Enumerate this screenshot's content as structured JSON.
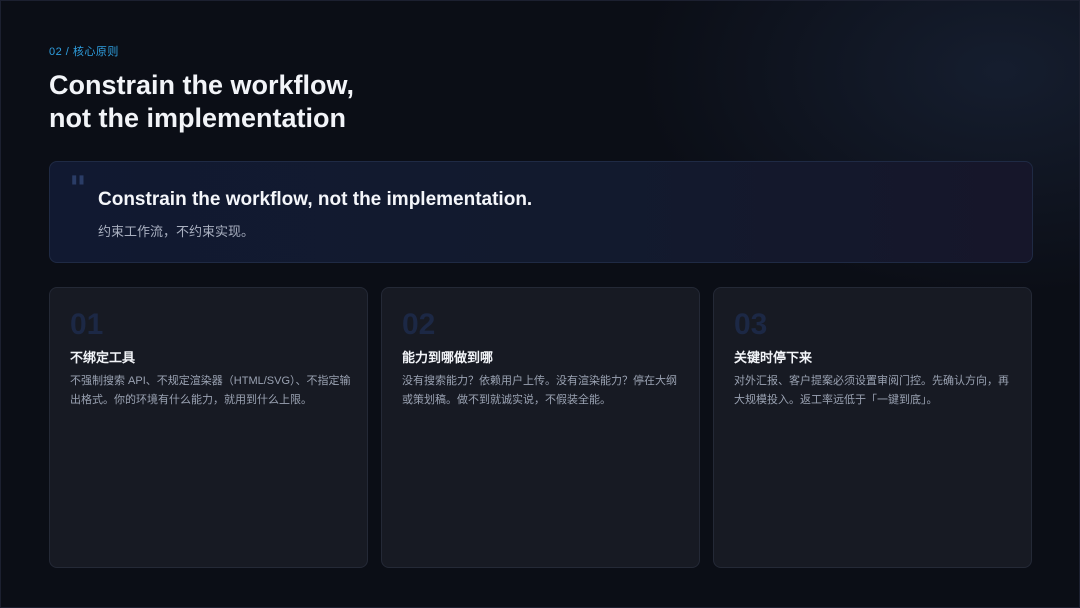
{
  "kicker": "02 / 核心原则",
  "heading": {
    "line1": "Constrain the workflow,",
    "line2": "not the implementation"
  },
  "quote": {
    "mark": "\"",
    "english": "Constrain the workflow, not the implementation.",
    "chinese": "约束工作流，不约束实现。"
  },
  "principles": [
    {
      "number": "01",
      "title": "不绑定工具",
      "description": "不强制搜索 API、不规定渲染器（HTML/SVG）、不指定输出格式。你的环境有什么能力，就用到什么上限。"
    },
    {
      "number": "02",
      "title": "能力到哪做到哪",
      "description": "没有搜索能力？依赖用户上传。没有渲染能力？停在大纲或策划稿。做不到就诚实说，不假装全能。"
    },
    {
      "number": "03",
      "title": "关键时停下来",
      "description": "对外汇报、客户提案必须设置审阅门控。先确认方向，再大规模投入。返工率远低于「一键到底」。"
    }
  ],
  "colors": {
    "accent": "#2f9fe0",
    "background": "#0b0e16",
    "card": "#171a23",
    "number": "#1c2845"
  }
}
